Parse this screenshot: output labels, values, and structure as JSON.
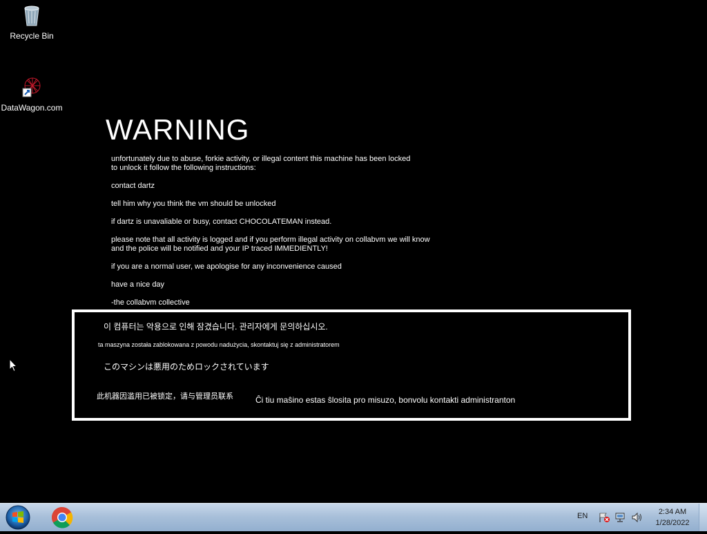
{
  "desktop": {
    "icons": [
      {
        "label": "Recycle Bin",
        "icon": "recycle-bin-icon"
      },
      {
        "label": "DataWagon.com",
        "icon": "datawagon-shortcut-icon"
      }
    ]
  },
  "warning": {
    "title": "WARNING",
    "paragraphs": [
      "unfortunately due to abuse, forkie activity, or illegal content this machine has been locked\nto unlock it follow the following instructions:",
      "contact dartz",
      "tell him why you think the vm should be unlocked",
      "if dartz is unavaliable or busy, contact CHOCOLATEMAN instead.",
      "please note that all activity is logged and if you perform illegal activity on collabvm we will know\nand the police will be notified and your IP traced IMMEDIENTLY!",
      "if you are a normal user, we apologise for any inconvenience caused",
      "have a nice day",
      "-the collabvm collective"
    ]
  },
  "languages": {
    "korean": "이 컴퓨터는 악용으로 인해 잠겼습니다. 관리자에게 문의하십시오.",
    "polish": "ta maszyna została zablokowana z powodu nadużycia, skontaktuj się z administratorem",
    "japanese": "このマシンは悪用のためロックされています",
    "chinese": "此机器因滥用已被锁定，请与管理员联系",
    "esperanto": "Ĉi tiu maŝino estas ŝlosita pro misuzo, bonvolu kontakti administranton"
  },
  "taskbar": {
    "start_icon": "windows-start-icon",
    "pinned": [
      {
        "icon": "chrome-icon"
      }
    ],
    "tray": {
      "language": "EN",
      "time": "2:34 AM",
      "date": "1/28/2022"
    }
  },
  "colors": {
    "background": "#000000",
    "text": "#ffffff",
    "taskbar": "#a9c0da"
  }
}
